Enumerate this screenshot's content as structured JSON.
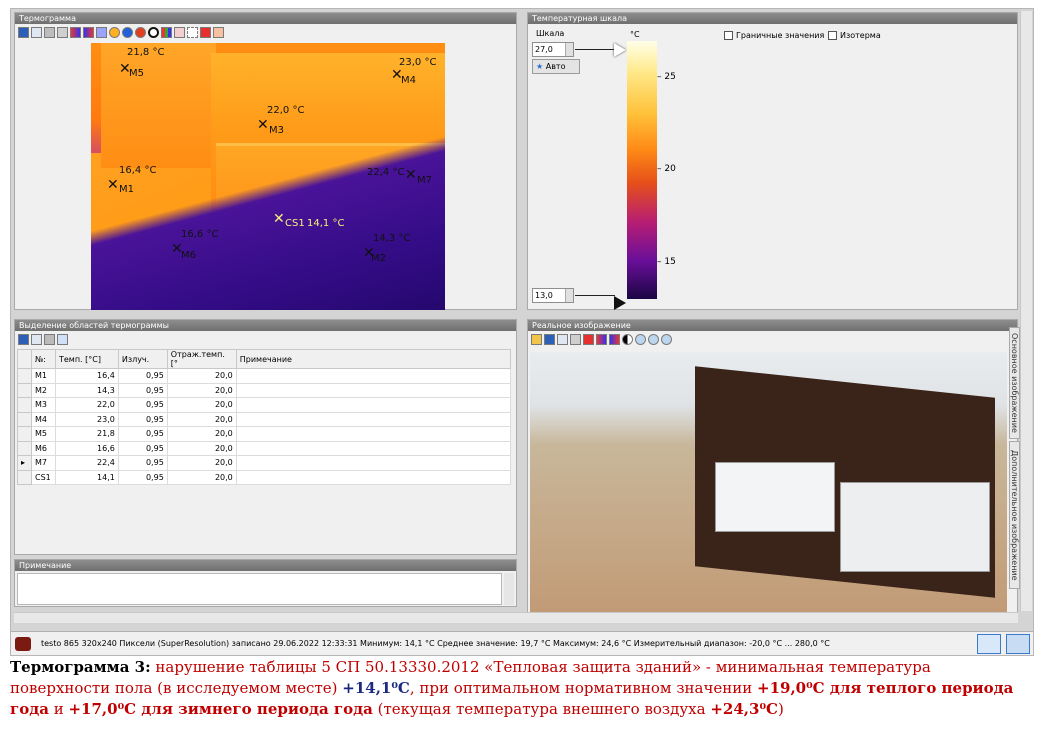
{
  "thermogram": {
    "title": "Термограмма",
    "markers": [
      {
        "id": "M5",
        "temp": "21,8 °C"
      },
      {
        "id": "M4",
        "temp": "23,0 °C"
      },
      {
        "id": "M3",
        "temp": "22,0 °C"
      },
      {
        "id": "M1",
        "temp": "16,4 °C"
      },
      {
        "id": "M7",
        "temp": "22,4 °C"
      },
      {
        "id": "CS1",
        "temp": "14,1 °C"
      },
      {
        "id": "M6",
        "temp": "16,6 °C"
      },
      {
        "id": "M2",
        "temp": "14,3 °C"
      }
    ]
  },
  "scale_panel": {
    "title": "Температурная шкала",
    "scale_label": "Шкала",
    "unit": "°C",
    "max_value": "27,0",
    "min_value": "13,0",
    "auto_button": "Авто",
    "ticks": [
      "25",
      "20",
      "15"
    ],
    "boundary_label": "Граничные значения",
    "isotherm_label": "Изотерма"
  },
  "regions": {
    "title": "Выделение областей термограммы",
    "columns": [
      "№:",
      "Темп. [°C]",
      "Излуч.",
      "Отраж.темп. [°",
      "Примечание"
    ],
    "rows": [
      {
        "id": "M1",
        "temp": "16,4",
        "emis": "0,95",
        "refl": "20,0",
        "note": ""
      },
      {
        "id": "M2",
        "temp": "14,3",
        "emis": "0,95",
        "refl": "20,0",
        "note": ""
      },
      {
        "id": "M3",
        "temp": "22,0",
        "emis": "0,95",
        "refl": "20,0",
        "note": ""
      },
      {
        "id": "M4",
        "temp": "23,0",
        "emis": "0,95",
        "refl": "20,0",
        "note": ""
      },
      {
        "id": "M5",
        "temp": "21,8",
        "emis": "0,95",
        "refl": "20,0",
        "note": ""
      },
      {
        "id": "M6",
        "temp": "16,6",
        "emis": "0,95",
        "refl": "20,0",
        "note": ""
      },
      {
        "id": "M7",
        "temp": "22,4",
        "emis": "0,95",
        "refl": "20,0",
        "note": ""
      },
      {
        "id": "CS1",
        "temp": "14,1",
        "emis": "0,95",
        "refl": "20,0",
        "note": ""
      }
    ]
  },
  "note_panel": {
    "title": "Примечание"
  },
  "real_image": {
    "title": "Реальное изображение",
    "tab_main": "Основное изображение",
    "tab_extra": "Дополнительное изображение"
  },
  "status": {
    "text": "testo 865 320x240 Пиксели (SuperResolution) записано 29.06.2022 12:33:31 Минимум: 14,1 °C Среднее значение: 19,7 °C Максимум: 24,6 °C Измерительный диапазон: -20,0 °C ... 280,0 °C"
  },
  "caption": {
    "label": "Термограмма 3:",
    "p1": " нарушение таблицы 5 СП 50.13330.2012 «Тепловая защита зданий» - минимальная температура поверхности пола (в исследуемом месте) ",
    "v1": "+14,1⁰С",
    "p2": ", при оптимальном нормативном значении ",
    "v2": "+19,0⁰С для теплого периода года",
    "p3": " и ",
    "v3": "+17,0⁰С для зимнего периода года",
    "p4": " (текущая температура внешнего воздуха ",
    "v4": "+24,3⁰С",
    "p5": ")"
  },
  "colors": {
    "caption_red": "#c00000",
    "caption_blue": "#1a2a80",
    "panel_title": "#7a7a7a"
  }
}
